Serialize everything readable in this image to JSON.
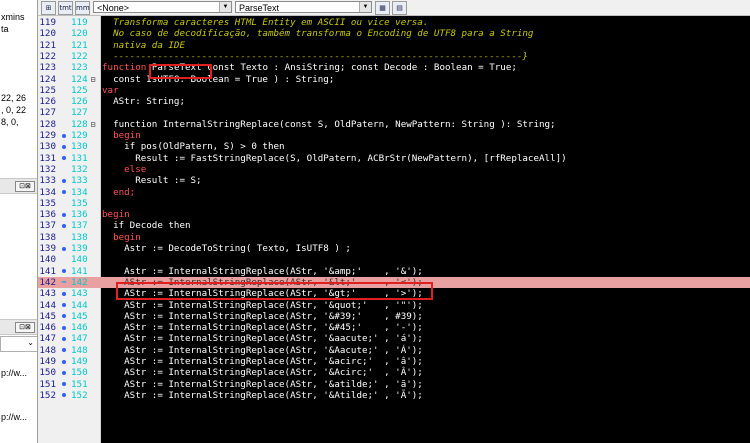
{
  "left_panel": {
    "texts": [
      "xmins",
      "ta",
      "22, 26",
      ", 0, 22",
      "8, 0,"
    ],
    "bar_btn": "⊡⊠",
    "combo_arrow": "⌄",
    "urls": [
      "p://w...",
      "p://w..."
    ]
  },
  "toolbar": {
    "icon1": "⊞",
    "icon2": "tmt",
    "icon3": "mm",
    "scope_combo": "<None>",
    "method_combo": "ParseText",
    "icon4": "▦",
    "icon5": "▤"
  },
  "editor": {
    "lines": [
      {
        "n": "119",
        "n2": "119",
        "mark": "",
        "fold": "",
        "kind": "cm",
        "text": "  Transforma caracteres HTML Entity em ASCII ou vice versa."
      },
      {
        "n": "120",
        "n2": "120",
        "mark": "",
        "fold": "",
        "kind": "cm",
        "text": "  No caso de decodificação, também transforma o Encoding de UTF8 para a String"
      },
      {
        "n": "121",
        "n2": "121",
        "mark": "",
        "fold": "",
        "kind": "cm",
        "text": "  nativa da IDE"
      },
      {
        "n": "122",
        "n2": "122",
        "mark": "",
        "fold": "",
        "kind": "cm",
        "text": "  --------------------------------------------------------------------------}"
      },
      {
        "n": "123",
        "n2": "123",
        "mark": "",
        "fold": "",
        "kind": "fn",
        "text": ""
      },
      {
        "n": "124",
        "n2": "124",
        "mark": "",
        "fold": "⊟",
        "kind": "raw",
        "text": "  const IsUTF8: Boolean = True ) : String;"
      },
      {
        "n": "125",
        "n2": "125",
        "mark": "",
        "fold": "",
        "kind": "kw",
        "text": "var"
      },
      {
        "n": "126",
        "n2": "126",
        "mark": "",
        "fold": "",
        "kind": "raw",
        "text": "  AStr: String;"
      },
      {
        "n": "127",
        "n2": "127",
        "mark": "",
        "fold": "",
        "kind": "raw",
        "text": ""
      },
      {
        "n": "128",
        "n2": "128",
        "mark": "",
        "fold": "⊟",
        "kind": "raw",
        "text": "  function InternalStringReplace(const S, OldPatern, NewPattern: String ): String;"
      },
      {
        "n": "129",
        "n2": "129",
        "mark": "dot",
        "fold": "",
        "kind": "kw",
        "text": "  begin"
      },
      {
        "n": "130",
        "n2": "130",
        "mark": "dot",
        "fold": "",
        "kind": "raw",
        "text": "    if pos(OldPatern, S) > 0 then"
      },
      {
        "n": "131",
        "n2": "131",
        "mark": "dot",
        "fold": "",
        "kind": "raw",
        "text": "      Result := FastStringReplace(S, OldPatern, ACBrStr(NewPattern), [rfReplaceAll])"
      },
      {
        "n": "132",
        "n2": "132",
        "mark": "",
        "fold": "",
        "kind": "kw",
        "text": "    else"
      },
      {
        "n": "133",
        "n2": "133",
        "mark": "dot",
        "fold": "",
        "kind": "raw",
        "text": "      Result := S;"
      },
      {
        "n": "134",
        "n2": "134",
        "mark": "dot",
        "fold": "",
        "kind": "kw",
        "text": "  end;"
      },
      {
        "n": "135",
        "n2": "135",
        "mark": "",
        "fold": "",
        "kind": "raw",
        "text": ""
      },
      {
        "n": "136",
        "n2": "136",
        "mark": "dot",
        "fold": "",
        "kind": "kw",
        "text": "begin"
      },
      {
        "n": "137",
        "n2": "137",
        "mark": "dot",
        "fold": "",
        "kind": "raw",
        "text": "  if Decode then"
      },
      {
        "n": "138",
        "n2": "138",
        "mark": "",
        "fold": "",
        "kind": "kw",
        "text": "  begin"
      },
      {
        "n": "139",
        "n2": "139",
        "mark": "dot",
        "fold": "",
        "kind": "raw",
        "text": "    Astr := DecodeToString( Texto, IsUTF8 ) ;"
      },
      {
        "n": "140",
        "n2": "140",
        "mark": "",
        "fold": "",
        "kind": "raw",
        "text": ""
      },
      {
        "n": "141",
        "n2": "141",
        "mark": "dot",
        "fold": "",
        "kind": "raw",
        "text": "    Astr := InternalStringReplace(AStr, '&amp;'    , '&');"
      },
      {
        "n": "142",
        "n2": "142",
        "mark": "arrow",
        "fold": "",
        "kind": "hl",
        "text": "    AStr := InternalStringReplace(AStr, '&lt;'     , '<');"
      },
      {
        "n": "143",
        "n2": "143",
        "mark": "dot",
        "fold": "",
        "kind": "raw",
        "text": "    AStr := InternalStringReplace(AStr, '&gt;'     , '>');"
      },
      {
        "n": "144",
        "n2": "144",
        "mark": "dot",
        "fold": "",
        "kind": "raw",
        "text": "    AStr := InternalStringReplace(AStr, '&quot;'   , '\"');"
      },
      {
        "n": "145",
        "n2": "145",
        "mark": "dot",
        "fold": "",
        "kind": "raw",
        "text": "    AStr := InternalStringReplace(AStr, '&#39;'    , #39);"
      },
      {
        "n": "146",
        "n2": "146",
        "mark": "dot",
        "fold": "",
        "kind": "raw",
        "text": "    AStr := InternalStringReplace(AStr, '&#45;'    , '-');"
      },
      {
        "n": "147",
        "n2": "147",
        "mark": "dot",
        "fold": "",
        "kind": "raw",
        "text": "    AStr := InternalStringReplace(AStr, '&aacute;' , 'á');"
      },
      {
        "n": "148",
        "n2": "148",
        "mark": "dot",
        "fold": "",
        "kind": "raw",
        "text": "    AStr := InternalStringReplace(AStr, '&Aacute;' , 'Á');"
      },
      {
        "n": "149",
        "n2": "149",
        "mark": "dot",
        "fold": "",
        "kind": "raw",
        "text": "    AStr := InternalStringReplace(AStr, '&acirc;'  , 'â');"
      },
      {
        "n": "150",
        "n2": "150",
        "mark": "dot",
        "fold": "",
        "kind": "raw",
        "text": "    AStr := InternalStringReplace(AStr, '&Acirc;'  , 'Â');"
      },
      {
        "n": "151",
        "n2": "151",
        "mark": "dot",
        "fold": "",
        "kind": "raw",
        "text": "    AStr := InternalStringReplace(AStr, '&atilde;' , 'ã');"
      },
      {
        "n": "152",
        "n2": "152",
        "mark": "dot",
        "fold": "",
        "kind": "raw",
        "text": "    AStr := InternalStringReplace(AStr, '&Atilde;' , 'Ã');"
      }
    ],
    "fn_keyword": "function",
    "fn_name": "ParseText",
    "fn_rest": " const Texto : AnsiString; const Decode : Boolean = True;",
    "colors": {
      "background": "#000000",
      "comment": "#c8c800",
      "keyword": "#ff5050",
      "text": "#ffffff",
      "highlight_line": "#e8a0a0",
      "annotation_box": "#e02020"
    }
  }
}
